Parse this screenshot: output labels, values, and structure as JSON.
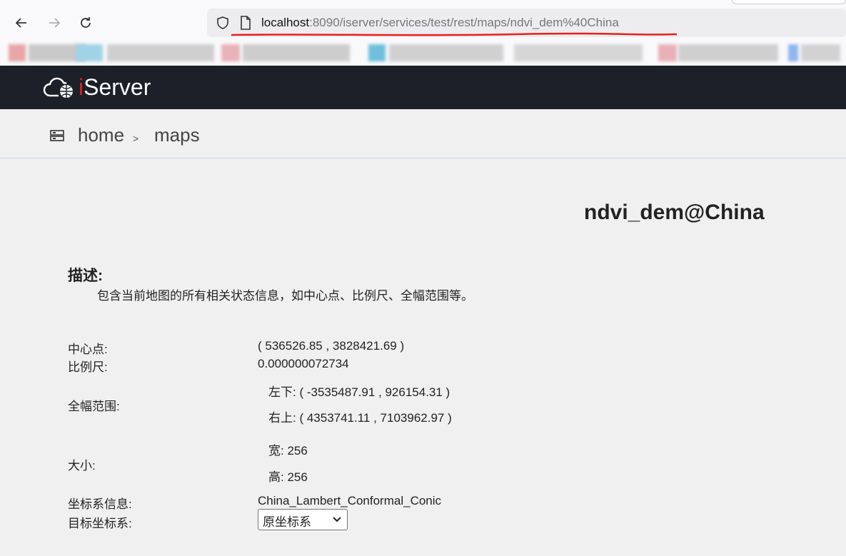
{
  "browser": {
    "url_host": "localhost",
    "url_rest": ":8090/iserver/services/test/rest/maps/ndvi_dem%40China"
  },
  "app": {
    "logo_i": "i",
    "logo_rest": "Server"
  },
  "breadcrumb": {
    "home": "home",
    "sep": ">",
    "current": "maps"
  },
  "page": {
    "title": "ndvi_dem@China",
    "description_label": "描述:",
    "description_text": "包含当前地图的所有相关状态信息，如中心点、比例尺、全幅范围等。"
  },
  "info": {
    "center_label": "中心点:",
    "center_value": "( 536526.85 , 3828421.69 )",
    "scale_label": "比例尺:",
    "scale_value": "0.000000072734",
    "bounds_label": "全幅范围:",
    "bounds_lower_left": "左下:  ( -3535487.91 , 926154.31 )",
    "bounds_upper_right": "右上:  ( 4353741.11 , 7103962.97 )",
    "size_label": "大小:",
    "size_width": "宽:  256",
    "size_height": "高:  256",
    "crs_label": "坐标系信息:",
    "crs_value": "China_Lambert_Conformal_Conic",
    "target_crs_label": "目标坐标系:",
    "target_crs_selected": "原坐标系"
  },
  "colors": {
    "header_bg": "#1b2029",
    "logo_accent": "#e01f1f",
    "annotation_red": "#e8201c"
  }
}
